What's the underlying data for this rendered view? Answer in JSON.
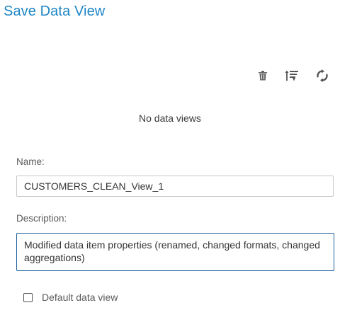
{
  "dialog": {
    "title": "Save Data View"
  },
  "toolbar": {
    "icons": [
      "trash-icon",
      "sort-icon",
      "refresh-icon"
    ],
    "icon_color": "#5b5b5b"
  },
  "views": {
    "empty_message": "No data views"
  },
  "form": {
    "name_label": "Name:",
    "name_value": "CUSTOMERS_CLEAN_View_1",
    "description_label": "Description:",
    "description_value": "Modified data item properties (renamed, changed formats, changed aggregations)",
    "default_label": "Default data view",
    "default_checked": false
  },
  "colors": {
    "title": "#1f86c5",
    "focus_border": "#1f5f9a",
    "input_border": "#c8c8c8"
  }
}
